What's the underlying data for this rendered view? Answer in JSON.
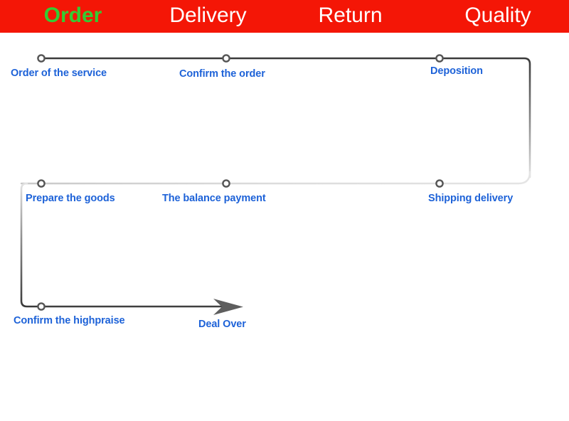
{
  "header": {
    "background_color": "#f41606",
    "active_color": "#33cc33",
    "inactive_color": "#ffffff",
    "items": [
      {
        "label": "Order",
        "active": true
      },
      {
        "label": "Delivery",
        "active": false
      },
      {
        "label": "Return",
        "active": false
      },
      {
        "label": "Quality",
        "active": false
      }
    ]
  },
  "flow": {
    "label_color": "#1d62d8",
    "line_color_dark": "#3a3a3a",
    "line_color_light": "#dcdcdc",
    "node_fill": "#ffffff",
    "node_stroke": "#555555",
    "arrow_color": "#5a5a5a",
    "steps": [
      {
        "label": "Order of the service",
        "row": 1,
        "index": 1
      },
      {
        "label": "Confirm the order",
        "row": 1,
        "index": 2
      },
      {
        "label": "Deposition",
        "row": 1,
        "index": 3
      },
      {
        "label": "Prepare the goods",
        "row": 2,
        "index": 4
      },
      {
        "label": "The balance payment",
        "row": 2,
        "index": 5
      },
      {
        "label": "Shipping delivery",
        "row": 2,
        "index": 6
      },
      {
        "label": "Confirm the highpraise",
        "row": 3,
        "index": 7
      },
      {
        "label": "Deal Over",
        "row": 3,
        "index": 8
      }
    ]
  }
}
